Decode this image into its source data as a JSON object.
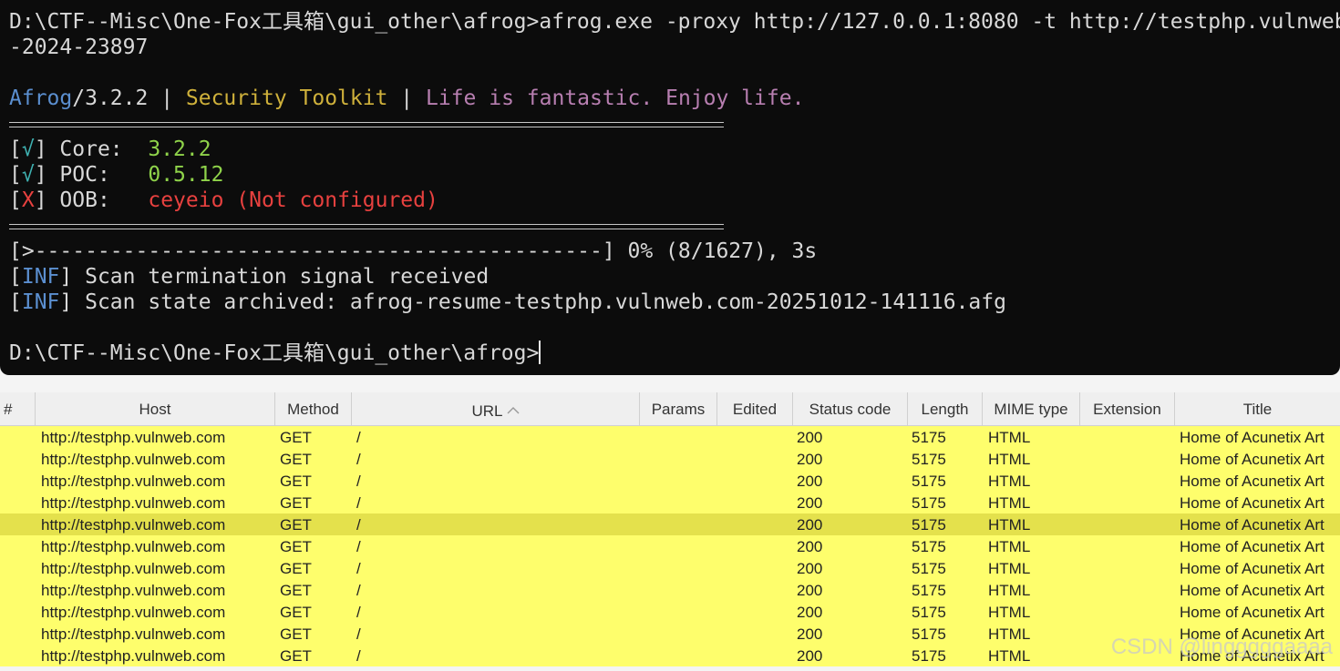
{
  "terminal": {
    "cmd_line1": "D:\\CTF--Misc\\One-Fox工具箱\\gui_other\\afrog>afrog.exe -proxy http://127.0.0.1:8080 -t http://testphp.vulnweb.com",
    "cmd_line2": "-2024-23897",
    "banner": {
      "name": "Afrog",
      "version": "/3.2.2",
      "pipe1": " | ",
      "toolkit": "Security Toolkit",
      "pipe2": " | ",
      "motto": "Life is fantastic. Enjoy life."
    },
    "status": [
      {
        "open": "[",
        "mark": "√",
        "close": "] ",
        "label": "Core:  ",
        "value": "3.2.2"
      },
      {
        "open": "[",
        "mark": "√",
        "close": "] ",
        "label": "POC:   ",
        "value": "0.5.12"
      },
      {
        "open": "[",
        "mark": "X",
        "close": "] ",
        "label": "OOB:   ",
        "value": "ceyeio (Not configured)"
      }
    ],
    "progress": "[>---------------------------------------------] 0% (8/1627), 3s",
    "logs": [
      {
        "tag": "INF",
        "text": " Scan termination signal received"
      },
      {
        "tag": "INF",
        "text": " Scan state archived: afrog-resume-testphp.vulnweb.com-20251012-141116.afg"
      }
    ],
    "prompt": "D:\\CTF--Misc\\One-Fox工具箱\\gui_other\\afrog>",
    "colors": {
      "background": "#0c0c0c",
      "blue": "#5b8fd0",
      "yellow": "#cfb13b",
      "magenta": "#b87fb1",
      "green": "#8fd34a",
      "red": "#e8413f"
    }
  },
  "table": {
    "headers": {
      "num": "#",
      "host": "Host",
      "method": "Method",
      "url": "URL",
      "params": "Params",
      "edited": "Edited",
      "status": "Status code",
      "length": "Length",
      "mime": "MIME type",
      "extension": "Extension",
      "title": "Title"
    },
    "rows": [
      {
        "host": "http://testphp.vulnweb.com",
        "method": "GET",
        "url": "/",
        "status": "200",
        "length": "5175",
        "mime": "HTML",
        "title": "Home of Acunetix Art"
      },
      {
        "host": "http://testphp.vulnweb.com",
        "method": "GET",
        "url": "/",
        "status": "200",
        "length": "5175",
        "mime": "HTML",
        "title": "Home of Acunetix Art"
      },
      {
        "host": "http://testphp.vulnweb.com",
        "method": "GET",
        "url": "/",
        "status": "200",
        "length": "5175",
        "mime": "HTML",
        "title": "Home of Acunetix Art"
      },
      {
        "host": "http://testphp.vulnweb.com",
        "method": "GET",
        "url": "/",
        "status": "200",
        "length": "5175",
        "mime": "HTML",
        "title": "Home of Acunetix Art"
      },
      {
        "host": "http://testphp.vulnweb.com",
        "method": "GET",
        "url": "/",
        "status": "200",
        "length": "5175",
        "mime": "HTML",
        "title": "Home of Acunetix Art"
      },
      {
        "host": "http://testphp.vulnweb.com",
        "method": "GET",
        "url": "/",
        "status": "200",
        "length": "5175",
        "mime": "HTML",
        "title": "Home of Acunetix Art"
      },
      {
        "host": "http://testphp.vulnweb.com",
        "method": "GET",
        "url": "/",
        "status": "200",
        "length": "5175",
        "mime": "HTML",
        "title": "Home of Acunetix Art"
      },
      {
        "host": "http://testphp.vulnweb.com",
        "method": "GET",
        "url": "/",
        "status": "200",
        "length": "5175",
        "mime": "HTML",
        "title": "Home of Acunetix Art"
      },
      {
        "host": "http://testphp.vulnweb.com",
        "method": "GET",
        "url": "/",
        "status": "200",
        "length": "5175",
        "mime": "HTML",
        "title": "Home of Acunetix Art"
      },
      {
        "host": "http://testphp.vulnweb.com",
        "method": "GET",
        "url": "/",
        "status": "200",
        "length": "5175",
        "mime": "HTML",
        "title": "Home of Acunetix Art"
      },
      {
        "host": "http://testphp.vulnweb.com",
        "method": "GET",
        "url": "/",
        "status": "200",
        "length": "5175",
        "mime": "HTML",
        "title": "Home of Acunetix Art"
      }
    ],
    "selected_row": 4,
    "highlight_color": "#fefe6c",
    "selected_color": "#e4e14c"
  },
  "watermark": "CSDN @lingggggaaaa"
}
